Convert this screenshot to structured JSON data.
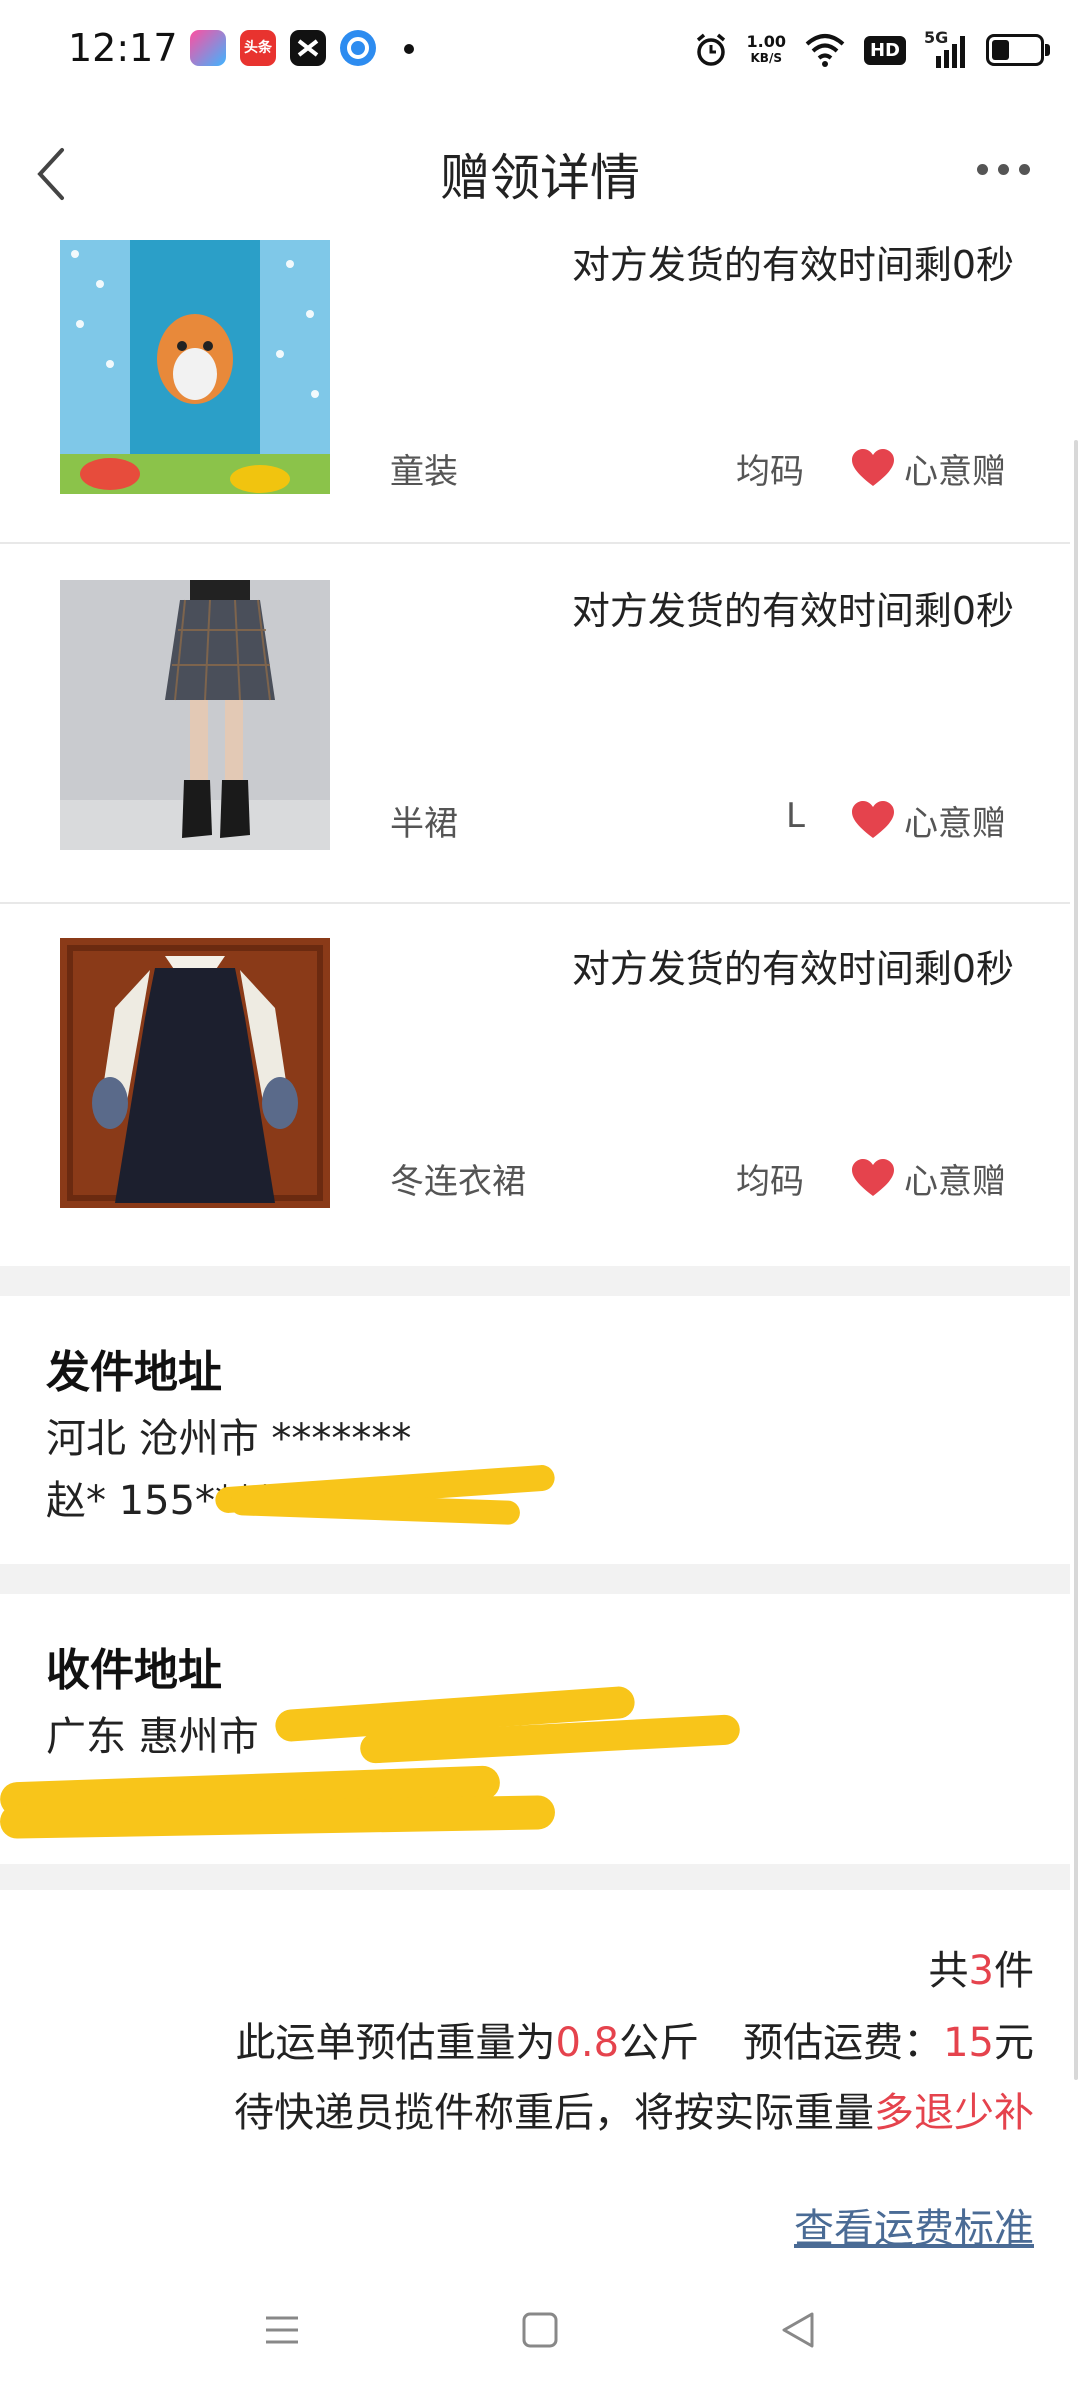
{
  "status_bar": {
    "time": "12:17",
    "net_speed_value": "1.00",
    "net_speed_unit": "KB/S",
    "hd": "HD",
    "signal": "5G",
    "app_icons": [
      "tv-app-icon",
      "toutiao-icon",
      "capcut-icon",
      "browser-icon"
    ],
    "app_icon_labels": [
      "",
      "头条",
      "",
      ""
    ]
  },
  "header": {
    "title": "赠领详情"
  },
  "items": [
    {
      "title": "对方发货的有效时间剩0秒",
      "category": "童装",
      "size": "均码",
      "gift_label": "心意赠"
    },
    {
      "title": "对方发货的有效时间剩0秒",
      "category": "半裙",
      "size": "L",
      "gift_label": "心意赠"
    },
    {
      "title": "对方发货的有效时间剩0秒",
      "category": "冬连衣裙",
      "size": "均码",
      "gift_label": "心意赠"
    }
  ],
  "sender": {
    "heading": "发件地址",
    "address": "河北 沧州市 *******",
    "contact": "赵* 155****"
  },
  "receiver": {
    "heading": "收件地址",
    "address": "广东 惠州市"
  },
  "summary": {
    "count_prefix": "共",
    "count": "3",
    "count_suffix": "件",
    "weight_prefix": "此运单预估重量为",
    "weight_value": "0.8",
    "weight_unit": "公斤",
    "fee_prefix": "预估运费：",
    "fee_value": "15",
    "fee_unit": "元",
    "note_prefix": "待快递员揽件称重后，将按实际重量",
    "note_highlight": "多退少补",
    "link": "查看运费标准"
  },
  "colors": {
    "accent_red": "#e5434d",
    "link_blue": "#4a6b95",
    "scribble_yellow": "#f8c51a"
  }
}
